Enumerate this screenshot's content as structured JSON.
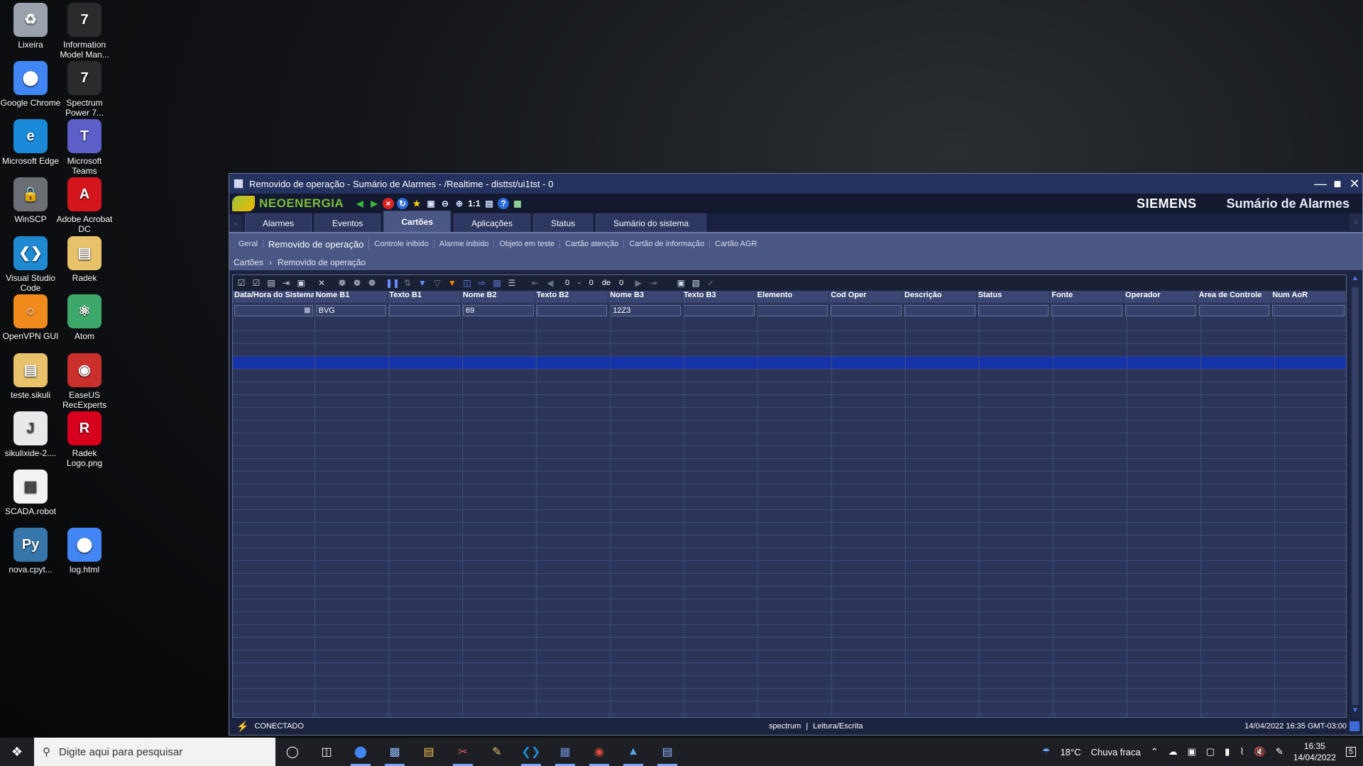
{
  "desktop": {
    "icons": [
      {
        "label": "Lixeira",
        "icon": "recycle-bin-icon",
        "color": "#9aa3ad"
      },
      {
        "label": "Information Model Man...",
        "icon": "information-model-manager-icon",
        "color": "#2b2b2b"
      },
      {
        "label": "Google Chrome",
        "icon": "chrome-icon",
        "color": "#4285f4"
      },
      {
        "label": "Spectrum Power 7...",
        "icon": "spectrum-power-icon",
        "color": "#2b2b2b"
      },
      {
        "label": "Microsoft Edge",
        "icon": "edge-icon",
        "color": "#1a8ad8"
      },
      {
        "label": "Microsoft Teams",
        "icon": "teams-icon",
        "color": "#5b5fc7"
      },
      {
        "label": "WinSCP",
        "icon": "winscp-icon",
        "color": "#6b6f75"
      },
      {
        "label": "Adobe Acrobat DC",
        "icon": "acrobat-icon",
        "color": "#d4161c"
      },
      {
        "label": "Visual Studio Code",
        "icon": "vscode-icon",
        "color": "#1f8ad2"
      },
      {
        "label": "Radek",
        "icon": "folder-icon",
        "color": "#e8c26a"
      },
      {
        "label": "OpenVPN GUI",
        "icon": "openvpn-icon",
        "color": "#f08a1d"
      },
      {
        "label": "Atom",
        "icon": "atom-icon",
        "color": "#3ea86b"
      },
      {
        "label": "teste.sikuli",
        "icon": "folder-icon",
        "color": "#e8c26a"
      },
      {
        "label": "EaseUS RecExperts",
        "icon": "easeus-icon",
        "color": "#c9302c"
      },
      {
        "label": "sikulixide-2....",
        "icon": "java-icon",
        "color": "#e9e9e9"
      },
      {
        "label": "Radek Logo.png",
        "icon": "image-file-icon",
        "color": "#d6001c"
      },
      {
        "label": "SCADA.robot",
        "icon": "text-file-icon",
        "color": "#f2f2f2"
      },
      {
        "label": "nova.cpyt...",
        "icon": "python-icon",
        "color": "#3776ab"
      },
      {
        "label": "log.html",
        "icon": "chrome-icon",
        "color": "#4285f4"
      }
    ]
  },
  "window": {
    "title": "Removido de operação - Sumário de Alarmes - /Realtime - disttst/ui1tst - 0",
    "brand": "NEOENERGIA",
    "siemens": "SIEMENS",
    "app_title": "Sumário de Alarmes",
    "zoom_label": "1:1",
    "tabs": [
      "Alarmes",
      "Eventos",
      "Cartões",
      "Aplicações",
      "Status",
      "Sumário do sistema"
    ],
    "active_tab": "Cartões",
    "subtabs": [
      "Geral",
      "Removido de operação",
      "Controle inibido",
      "Alarme inibido",
      "Objeto em teste",
      "Cartão atenção",
      "Cartão de informação",
      "Cartão AGR"
    ],
    "active_subtab": "Removido de operação",
    "breadcrumb": [
      "Cartões",
      "Removido de operação"
    ],
    "pager": {
      "from": "0",
      "dash": "-",
      "to": "0",
      "of_label": "de",
      "total": "0"
    },
    "columns": [
      "Data/Hora do Sistema",
      "Nome B1",
      "Texto B1",
      "Nome B2",
      "Texto B2",
      "Nome B3",
      "Texto B3",
      "Elemento",
      "Cod Oper",
      "Descrição",
      "Status",
      "Fonte",
      "Operador",
      "Área de Controle",
      "Num AoR"
    ],
    "filters": [
      "",
      "BVG",
      "",
      "69",
      "",
      "12Z3",
      "",
      "",
      "",
      "",
      "",
      "",
      "",
      "",
      ""
    ],
    "status": {
      "connection": "CONECTADO",
      "user": "spectrum",
      "separator": "|",
      "mode": "Leitura/Escrita",
      "datetime": "14/04/2022 16:35 GMT-03:00"
    }
  },
  "taskbar": {
    "search_placeholder": "Digite aqui para pesquisar",
    "weather_temp": "18°C",
    "weather_text": "Chuva fraca",
    "time": "16:35",
    "date": "14/04/2022",
    "notification_count": "5"
  }
}
